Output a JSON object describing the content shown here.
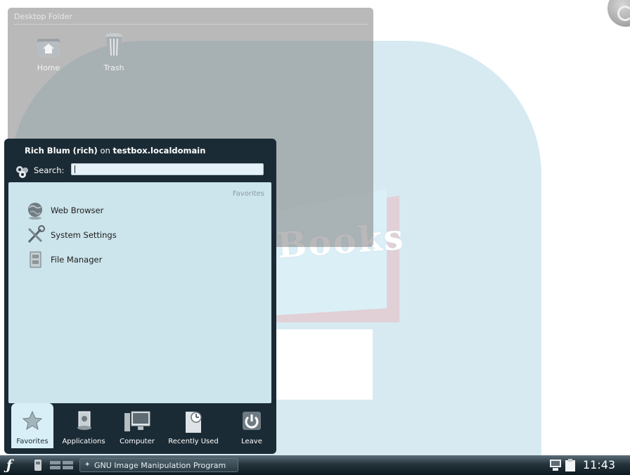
{
  "desktop_folder": {
    "title": "Desktop Folder",
    "items": [
      {
        "label": "Home",
        "icon": "home-folder-icon"
      },
      {
        "label": "Trash",
        "icon": "trash-icon"
      }
    ]
  },
  "watermark": {
    "text": "DropBooks"
  },
  "launcher": {
    "user_name": "Rich Blum (rich)",
    "user_on": " on ",
    "host": "testbox.localdomain",
    "search_label": "Search:",
    "search_value": "",
    "pane_title": "Favorites",
    "favorites": [
      {
        "label": "Web Browser",
        "icon": "web-browser-icon"
      },
      {
        "label": "System Settings",
        "icon": "system-settings-icon"
      },
      {
        "label": "File Manager",
        "icon": "file-manager-icon"
      }
    ],
    "tabs": [
      {
        "label": "Favorites",
        "icon": "star-icon",
        "active": true
      },
      {
        "label": "Applications",
        "icon": "applications-icon",
        "active": false
      },
      {
        "label": "Computer",
        "icon": "computer-icon",
        "active": false
      },
      {
        "label": "Recently Used",
        "icon": "recently-used-icon",
        "active": false
      },
      {
        "label": "Leave",
        "icon": "power-icon",
        "active": false
      }
    ]
  },
  "taskbar": {
    "task_label": "GNU Image Manipulation Program",
    "clock": "11:43"
  },
  "colors": {
    "launcher_bg": "#1b2b35",
    "pane_bg": "#d6eef6",
    "taskbar": "#24333c"
  }
}
